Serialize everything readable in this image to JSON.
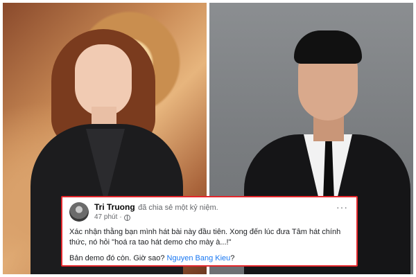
{
  "post": {
    "author": "Tri Truong",
    "action": "đã chia sẻ một kỷ niệm.",
    "time": "47 phút",
    "separator": "·",
    "more": "···",
    "line1": "Xác nhận thằng bạn mình hát bài này đầu tiên. Xong đến lúc đưa Tâm hát chính thức, nó hỏi \"hoá ra tao hát demo cho mày à...!\"",
    "line2_prefix": "Bản demo đó còn. Giờ sao?",
    "mention": "Nguyen Bang Kieu",
    "line2_suffix": "?"
  },
  "colors": {
    "highlight_border": "#e4262b",
    "mention": "#1877f2"
  },
  "icons": {
    "privacy": "globe-icon",
    "options": "more-options-icon"
  }
}
